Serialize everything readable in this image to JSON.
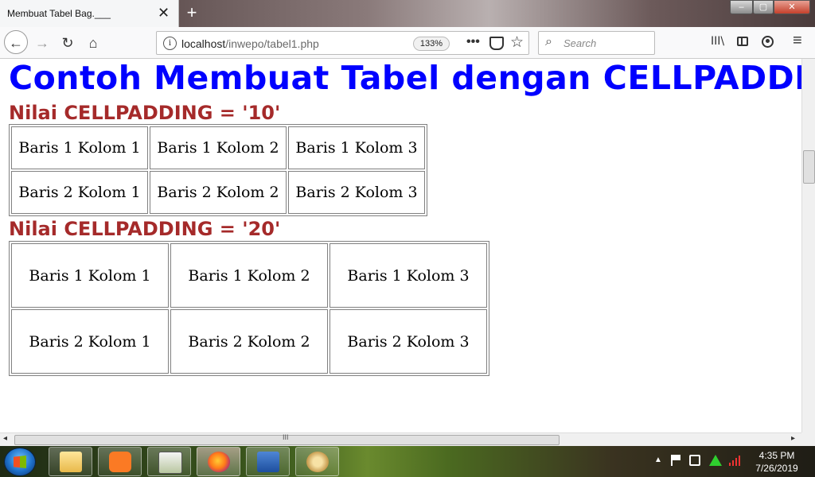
{
  "browser": {
    "tab_title": "Membuat Tabel Bag.___",
    "tab_close": "✕",
    "new_tab": "+",
    "window_controls": {
      "minimize": "–",
      "maximize": "▢",
      "close": "✕"
    },
    "nav": {
      "back": "←",
      "forward": "→",
      "reload": "↻",
      "home": "⌂"
    },
    "url": {
      "host": "localhost",
      "path": "/inwepo/tabel1.php",
      "info": "i"
    },
    "zoom": "133%",
    "more": "•••",
    "star": "☆",
    "search_placeholder": "Search",
    "library": "III\\",
    "menu": "≡"
  },
  "page": {
    "title": "Contoh Membuat Tabel dengan CELLPADDING",
    "subtitle1": "Nilai CELLPADDING = '10'",
    "subtitle2": "Nilai CELLPADDING = '20'",
    "table1": [
      [
        "Baris 1 Kolom 1",
        "Baris 1 Kolom 2",
        "Baris 1 Kolom 3"
      ],
      [
        "Baris 2 Kolom 1",
        "Baris 2 Kolom 2",
        "Baris 2 Kolom 3"
      ]
    ],
    "table2": [
      [
        "Baris 1 Kolom 1",
        "Baris 1 Kolom 2",
        "Baris 1 Kolom 3"
      ],
      [
        "Baris 2 Kolom 1",
        "Baris 2 Kolom 2",
        "Baris 2 Kolom 3"
      ]
    ]
  },
  "scrollbar": {
    "left": "◂",
    "right": "▸",
    "grip": "III"
  },
  "taskbar": {
    "tray_up": "▲",
    "time": "4:35 PM",
    "date": "7/26/2019"
  },
  "colors": {
    "title": "#0000ff",
    "subtitle": "#a52a2a"
  }
}
